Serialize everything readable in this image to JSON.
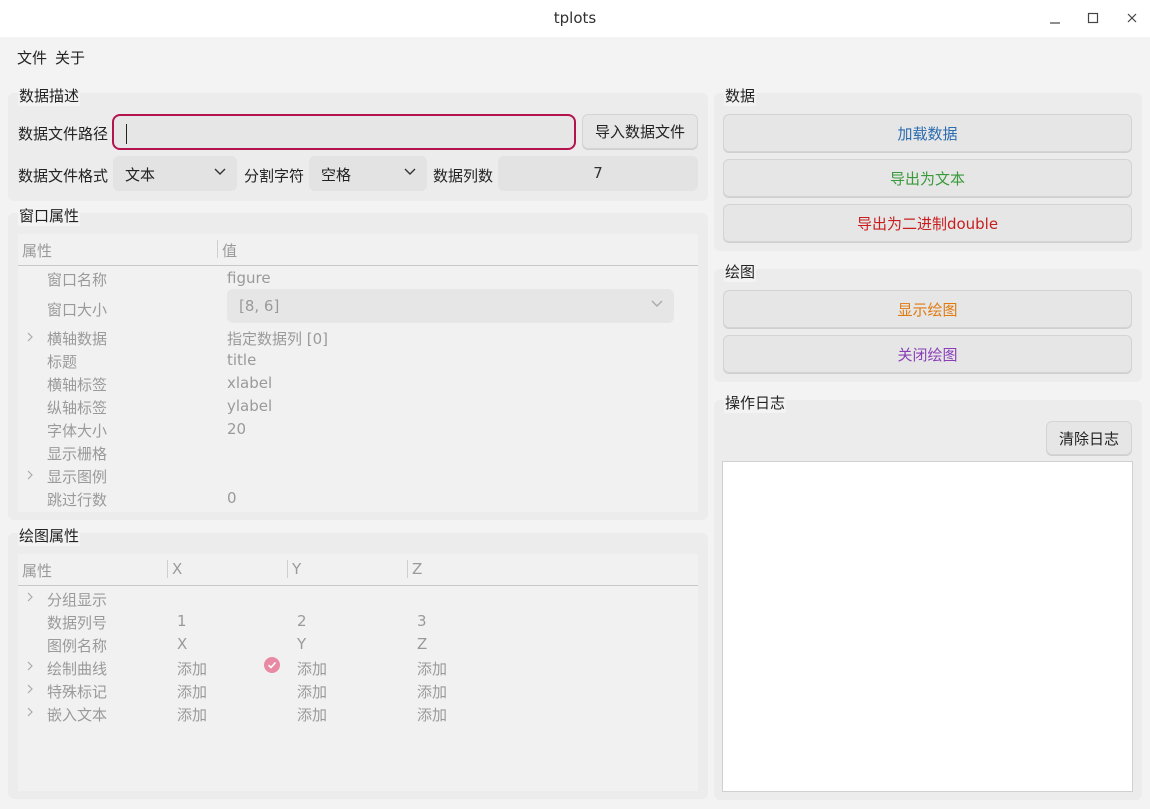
{
  "window": {
    "title": "tplots"
  },
  "menu": {
    "file": "文件",
    "about": "关于"
  },
  "data_desc": {
    "title": "数据描述",
    "path_label": "数据文件路径",
    "path_value": "",
    "import_button": "导入数据文件",
    "format_label": "数据文件格式",
    "format_value": "文本",
    "delimiter_label": "分割字符",
    "delimiter_value": "空格",
    "columns_label": "数据列数",
    "columns_value": "7"
  },
  "window_props": {
    "title": "窗口属性",
    "headers": [
      "属性",
      "值"
    ],
    "rows": [
      {
        "name": "窗口名称",
        "value": "figure"
      },
      {
        "name": "窗口大小",
        "value": "[8, 6]"
      },
      {
        "name": "横轴数据",
        "value": "指定数据列 [0]"
      },
      {
        "name": "标题",
        "value": "title"
      },
      {
        "name": "横轴标签",
        "value": "xlabel"
      },
      {
        "name": "纵轴标签",
        "value": "ylabel"
      },
      {
        "name": "字体大小",
        "value": "20"
      },
      {
        "name": "显示栅格",
        "value": ""
      },
      {
        "name": "显示图例",
        "value": ""
      },
      {
        "name": "跳过行数",
        "value": "0"
      }
    ]
  },
  "plot_props": {
    "title": "绘图属性",
    "headers": [
      "属性",
      "X",
      "Y",
      "Z"
    ],
    "rows": [
      {
        "name": "分组显示",
        "x": "",
        "y": "",
        "z": ""
      },
      {
        "name": "数据列号",
        "x": "1",
        "y": "2",
        "z": "3"
      },
      {
        "name": "图例名称",
        "x": "X",
        "y": "Y",
        "z": "Z"
      },
      {
        "name": "绘制曲线",
        "x": "添加",
        "y": "添加",
        "z": "添加"
      },
      {
        "name": "特殊标记",
        "x": "添加",
        "y": "添加",
        "z": "添加"
      },
      {
        "name": "嵌入文本",
        "x": "添加",
        "y": "添加",
        "z": "添加"
      }
    ]
  },
  "data_panel": {
    "title": "数据",
    "load_button": "加载数据",
    "export_text_button": "导出为文本",
    "export_binary_button": "导出为二进制double"
  },
  "plot_panel": {
    "title": "绘图",
    "show_button": "显示绘图",
    "close_button": "关闭绘图"
  },
  "log_panel": {
    "title": "操作日志",
    "clear_button": "清除日志",
    "content": ""
  },
  "colors": {
    "load": "#2b6cb0",
    "export_text": "#3a9a3a",
    "export_binary": "#c81e1e",
    "show": "#e07a10",
    "close": "#8a3fb8",
    "focus_border": "#b5134e",
    "check_badge": "#e88aa4"
  }
}
